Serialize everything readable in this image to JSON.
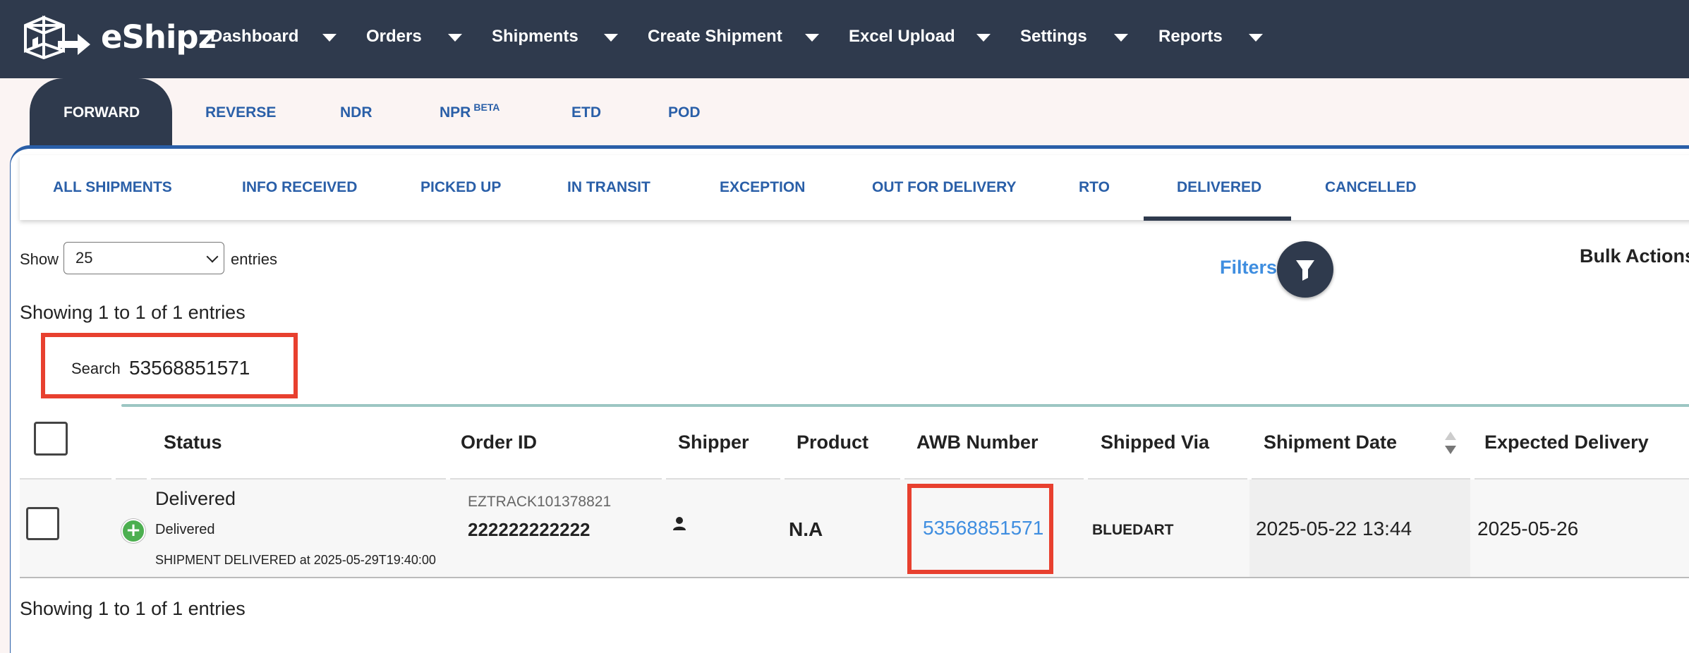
{
  "app": {
    "brand": "eShipz",
    "nav": [
      {
        "label": "Dashboard"
      },
      {
        "label": "Orders"
      },
      {
        "label": "Shipments"
      },
      {
        "label": "Create Shipment"
      },
      {
        "label": "Excel Upload"
      },
      {
        "label": "Settings"
      },
      {
        "label": "Reports"
      }
    ]
  },
  "primary_tabs": {
    "active": "FORWARD",
    "items": [
      "FORWARD",
      "REVERSE",
      "NDR",
      "NPR",
      "ETD",
      "POD"
    ],
    "npr_badge": "BETA"
  },
  "status_tabs": {
    "active": "DELIVERED",
    "items": [
      "ALL SHIPMENTS",
      "INFO RECEIVED",
      "PICKED UP",
      "IN TRANSIT",
      "EXCEPTION",
      "OUT FOR DELIVERY",
      "RTO",
      "DELIVERED",
      "CANCELLED"
    ]
  },
  "controls": {
    "show_label": "Show",
    "entries_value": "25",
    "entries_label": "entries",
    "filters_label": "Filters",
    "bulk_actions_label": "Bulk Actions",
    "showing_top": "Showing 1 to 1 of 1 entries",
    "showing_bottom": "Showing 1 to 1 of 1 entries",
    "search_label": "Search",
    "search_value": "53568851571"
  },
  "table": {
    "columns": [
      "Status",
      "Order ID",
      "Shipper",
      "Product",
      "AWB Number",
      "Shipped Via",
      "Shipment Date",
      "Expected Delivery"
    ],
    "rows": [
      {
        "status_title": "Delivered",
        "status_sub": "Delivered",
        "status_detail": "SHIPMENT DELIVERED at 2025-05-29T19:40:00",
        "order_ref": "EZTRACK101378821",
        "order_id": "222222222222",
        "product": "N.A",
        "awb": "53568851571",
        "shipped_via": "BLUEDART",
        "shipment_date": "2025-05-22 13:44",
        "expected_delivery": "2025-05-26"
      }
    ]
  },
  "colors": {
    "navbar": "#2f3a4d",
    "accent_blue": "#2a5fa8",
    "link_blue": "#3f8ee0",
    "highlight_red": "#e8402f",
    "status_green": "#4caf50"
  },
  "icons": [
    "logo-box-icon",
    "caret-down-icon",
    "filter-funnel-icon",
    "person-icon",
    "plus-icon",
    "sort-icon",
    "chevron-down-icon"
  ]
}
